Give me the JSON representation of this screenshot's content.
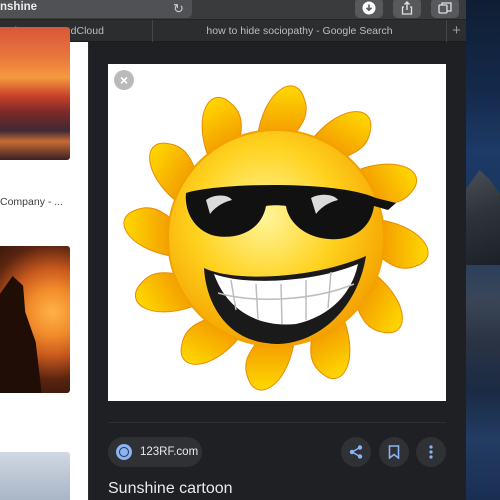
{
  "browser": {
    "address_text": "nshine",
    "tabs": [
      {
        "label": "tening on SoundCloud"
      },
      {
        "label": "how to hide sociopathy - Google Search"
      }
    ],
    "new_tab_label": "+"
  },
  "results": {
    "items": [
      {
        "caption": "Company - ..."
      }
    ]
  },
  "preview": {
    "source": "123RF.com",
    "title": "Sunshine cartoon",
    "close_label": "×"
  },
  "colors": {
    "accent": "#8ab4f8",
    "panel_bg": "#1f2023",
    "chip_bg": "#303134"
  }
}
